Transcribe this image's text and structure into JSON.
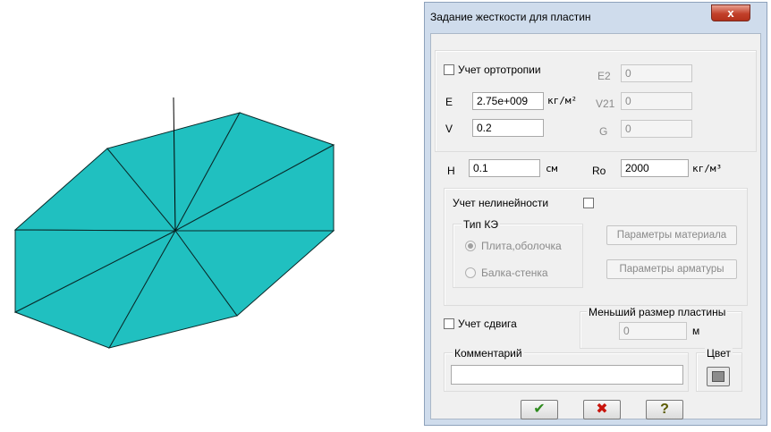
{
  "window": {
    "title": "Задание жесткости для пластин",
    "close_glyph": "x"
  },
  "orthotropy": {
    "checkbox_label": "Учет ортотропии",
    "e_label": "E",
    "e_value": "2.75e+009",
    "e_unit": "кг/м²",
    "v_label": "V",
    "v_value": "0.2",
    "e2_label": "E2",
    "e2_value": "0",
    "v21_label": "V21",
    "v21_value": "0",
    "g_label": "G",
    "g_value": "0"
  },
  "thickness": {
    "h_label": "H",
    "h_value": "0.1",
    "h_unit": "см",
    "ro_label": "Ro",
    "ro_value": "2000",
    "ro_unit": "кг/м³"
  },
  "nonlinearity": {
    "checkbox_label": "Учет нелинейности",
    "fe_type_label": "Тип КЭ",
    "options": [
      "Плита,оболочка",
      "Балка-стенка"
    ],
    "selected_option": "Плита,оболочка",
    "material_params_button": "Параметры материала",
    "reinforcement_params_button": "Параметры арматуры"
  },
  "shear": {
    "checkbox_label": "Учет сдвига"
  },
  "min_plate_size": {
    "label": "Меньший размер пластины",
    "value": "0",
    "unit": "м"
  },
  "comment": {
    "label": "Комментарий",
    "value": ""
  },
  "color": {
    "label": "Цвет",
    "swatch_color": "#8c8c8c"
  },
  "buttons": {
    "ok_glyph": "✔",
    "cancel_glyph": "✖",
    "help_glyph": "?"
  },
  "colors": {
    "plate_fill": "#20c0c0",
    "ok_color": "#2e8b1e",
    "cancel_color": "#c8140c",
    "help_color": "#5a5a00"
  }
}
